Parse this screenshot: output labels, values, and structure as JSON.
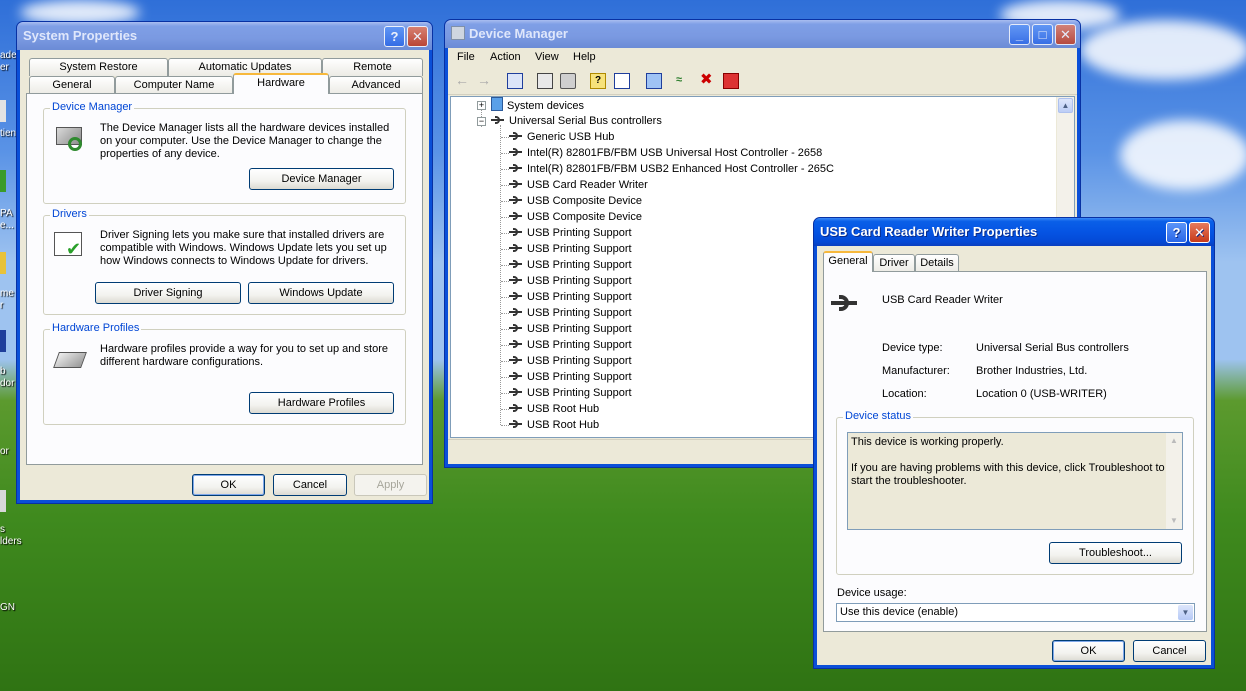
{
  "desktop": {
    "icon_label_fragments": [
      "ade",
      "er",
      "tien",
      "PA",
      "e...",
      "me",
      "r",
      "b",
      "dor",
      "or",
      "s",
      "lders",
      "GN"
    ]
  },
  "system_properties": {
    "title": "System Properties",
    "tabs_back": [
      "System Restore",
      "Automatic Updates",
      "Remote"
    ],
    "tabs_front": [
      "General",
      "Computer Name",
      "Hardware",
      "Advanced"
    ],
    "active_tab": "Hardware",
    "device_manager_group": {
      "label": "Device Manager",
      "text": "The Device Manager lists all the hardware devices installed on your computer. Use the Device Manager to change the properties of any device.",
      "button": "Device Manager"
    },
    "drivers_group": {
      "label": "Drivers",
      "text": "Driver Signing lets you make sure that installed drivers are compatible with Windows. Windows Update lets you set up how Windows connects to Windows Update for drivers.",
      "button_signing": "Driver Signing",
      "button_update": "Windows Update"
    },
    "hardware_profiles_group": {
      "label": "Hardware Profiles",
      "text": "Hardware profiles provide a way for you to set up and store different hardware configurations.",
      "button": "Hardware Profiles"
    },
    "buttons": {
      "ok": "OK",
      "cancel": "Cancel",
      "apply": "Apply"
    }
  },
  "device_manager": {
    "title": "Device Manager",
    "menu": [
      "File",
      "Action",
      "View",
      "Help"
    ],
    "tree": {
      "system_devices": "System devices",
      "usb_controllers": "Universal Serial Bus controllers",
      "children": [
        "Generic USB Hub",
        "Intel(R) 82801FB/FBM USB Universal Host Controller - 2658",
        "Intel(R) 82801FB/FBM USB2 Enhanced Host Controller - 265C",
        "USB Card Reader Writer",
        "USB Composite Device",
        "USB Composite Device",
        "USB Printing Support",
        "USB Printing Support",
        "USB Printing Support",
        "USB Printing Support",
        "USB Printing Support",
        "USB Printing Support",
        "USB Printing Support",
        "USB Printing Support",
        "USB Printing Support",
        "USB Printing Support",
        "USB Printing Support",
        "USB Root Hub",
        "USB Root Hub"
      ]
    }
  },
  "usb_properties": {
    "title": "USB Card Reader Writer Properties",
    "tabs": [
      "General",
      "Driver",
      "Details"
    ],
    "active_tab": "General",
    "device_name": "USB Card Reader Writer",
    "device_type_label": "Device type:",
    "device_type_value": "Universal Serial Bus controllers",
    "manufacturer_label": "Manufacturer:",
    "manufacturer_value": "Brother Industries, Ltd.",
    "location_label": "Location:",
    "location_value": "Location 0 (USB-WRITER)",
    "status_group_label": "Device status",
    "status_line1": "This device is working properly.",
    "status_line2": "If you are having problems with this device, click Troubleshoot to start the troubleshooter.",
    "troubleshoot_button": "Troubleshoot...",
    "usage_label": "Device usage:",
    "usage_value": "Use this device (enable)",
    "buttons": {
      "ok": "OK",
      "cancel": "Cancel"
    }
  }
}
